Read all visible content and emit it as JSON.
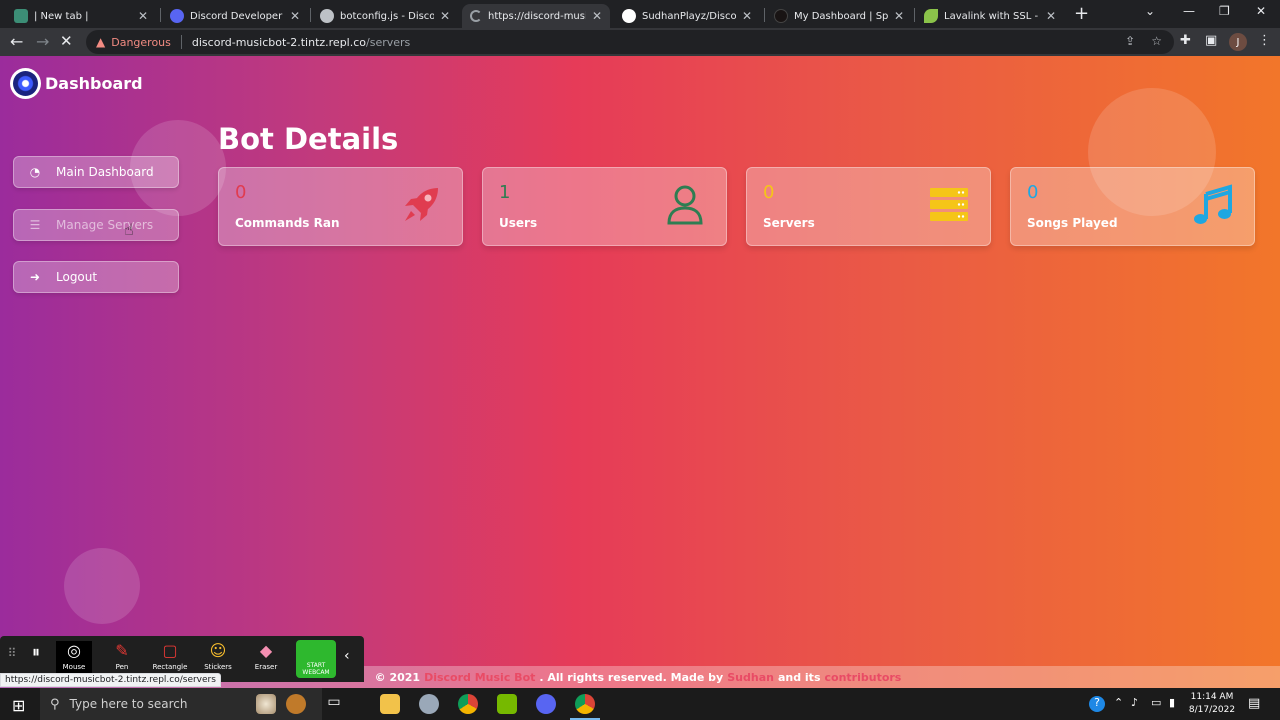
{
  "browser": {
    "tabs": [
      {
        "title": "| New tab |",
        "favicon_color": "#3c8e76"
      },
      {
        "title": "Discord Developer Port",
        "favicon_color": "#5865f2"
      },
      {
        "title": "botconfig.js - Discord-",
        "favicon_color": "#bdc1c6"
      },
      {
        "title": "https://discord-musicb",
        "favicon_color": "#35363a"
      },
      {
        "title": "SudhanPlayz/Discord-M",
        "favicon_color": "#ffffff"
      },
      {
        "title": "My Dashboard | Spotify",
        "favicon_color": "#191414"
      },
      {
        "title": "Lavalink with SSL - lava",
        "favicon_color": "#8bc34a"
      }
    ],
    "security_label": "Dangerous",
    "url_host": "discord-musicbot-2.tintz.repl.co",
    "url_path": "/servers",
    "profile_initial": "J",
    "status_url": "https://discord-musicbot-2.tintz.repl.co/servers"
  },
  "sidebar": {
    "brand": "Dashboard",
    "items": [
      {
        "label": "Main Dashboard",
        "icon": "dashboard-gauge-icon"
      },
      {
        "label": "Manage Servers",
        "icon": "server-list-icon"
      },
      {
        "label": "Logout",
        "icon": "logout-icon"
      }
    ]
  },
  "main": {
    "title": "Bot Details",
    "cards": [
      {
        "value": "0",
        "label": "Commands Ran",
        "icon": "rocket-icon",
        "color": "#e03c50"
      },
      {
        "value": "1",
        "label": "Users",
        "icon": "user-icon",
        "color": "#2e7d52"
      },
      {
        "value": "0",
        "label": "Servers",
        "icon": "server-icon",
        "color": "#f5c518"
      },
      {
        "value": "0",
        "label": "Songs Played",
        "icon": "music-note-icon",
        "color": "#1ea7e1"
      }
    ]
  },
  "footer": {
    "prefix": "© 2021",
    "bot_name": "Discord Music Bot",
    "middle": ". All rights reserved. Made by",
    "author": "Sudhan",
    "and_its": "and its",
    "contributors": "contributors"
  },
  "recorder": {
    "items": [
      "Mouse",
      "Pen",
      "Rectangle",
      "Stickers",
      "Eraser"
    ],
    "webcam": "START WEBCAM"
  },
  "taskbar": {
    "search_placeholder": "Type here to search",
    "time": "11:14 AM",
    "date": "8/17/2022"
  }
}
